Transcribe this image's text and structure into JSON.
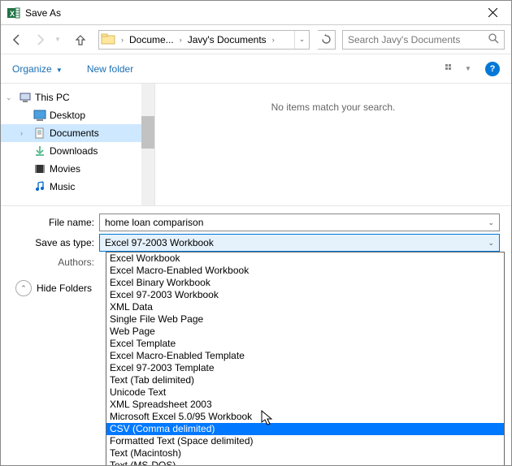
{
  "title": "Save As",
  "breadcrumb": {
    "seg1": "Docume...",
    "seg2": "Javy's Documents"
  },
  "search_placeholder": "Search Javy's Documents",
  "toolbar": {
    "organize": "Organize",
    "newfolder": "New folder"
  },
  "tree": {
    "thispc": "This PC",
    "desktop": "Desktop",
    "documents": "Documents",
    "downloads": "Downloads",
    "movies": "Movies",
    "music": "Music"
  },
  "content_msg": "No items match your search.",
  "form": {
    "filename_lbl": "File name:",
    "filename_val": "home loan comparison",
    "type_lbl": "Save as type:",
    "type_val": "Excel 97-2003 Workbook",
    "authors_lbl": "Authors:"
  },
  "hide_folders": "Hide Folders",
  "dropdown_items": [
    "Excel Workbook",
    "Excel Macro-Enabled Workbook",
    "Excel Binary Workbook",
    "Excel 97-2003 Workbook",
    "XML Data",
    "Single File Web Page",
    "Web Page",
    "Excel Template",
    "Excel Macro-Enabled Template",
    "Excel 97-2003 Template",
    "Text (Tab delimited)",
    "Unicode Text",
    "XML Spreadsheet 2003",
    "Microsoft Excel 5.0/95 Workbook",
    "CSV (Comma delimited)",
    "Formatted Text (Space delimited)",
    "Text (Macintosh)",
    "Text (MS-DOS)"
  ],
  "dropdown_selected_index": 14
}
